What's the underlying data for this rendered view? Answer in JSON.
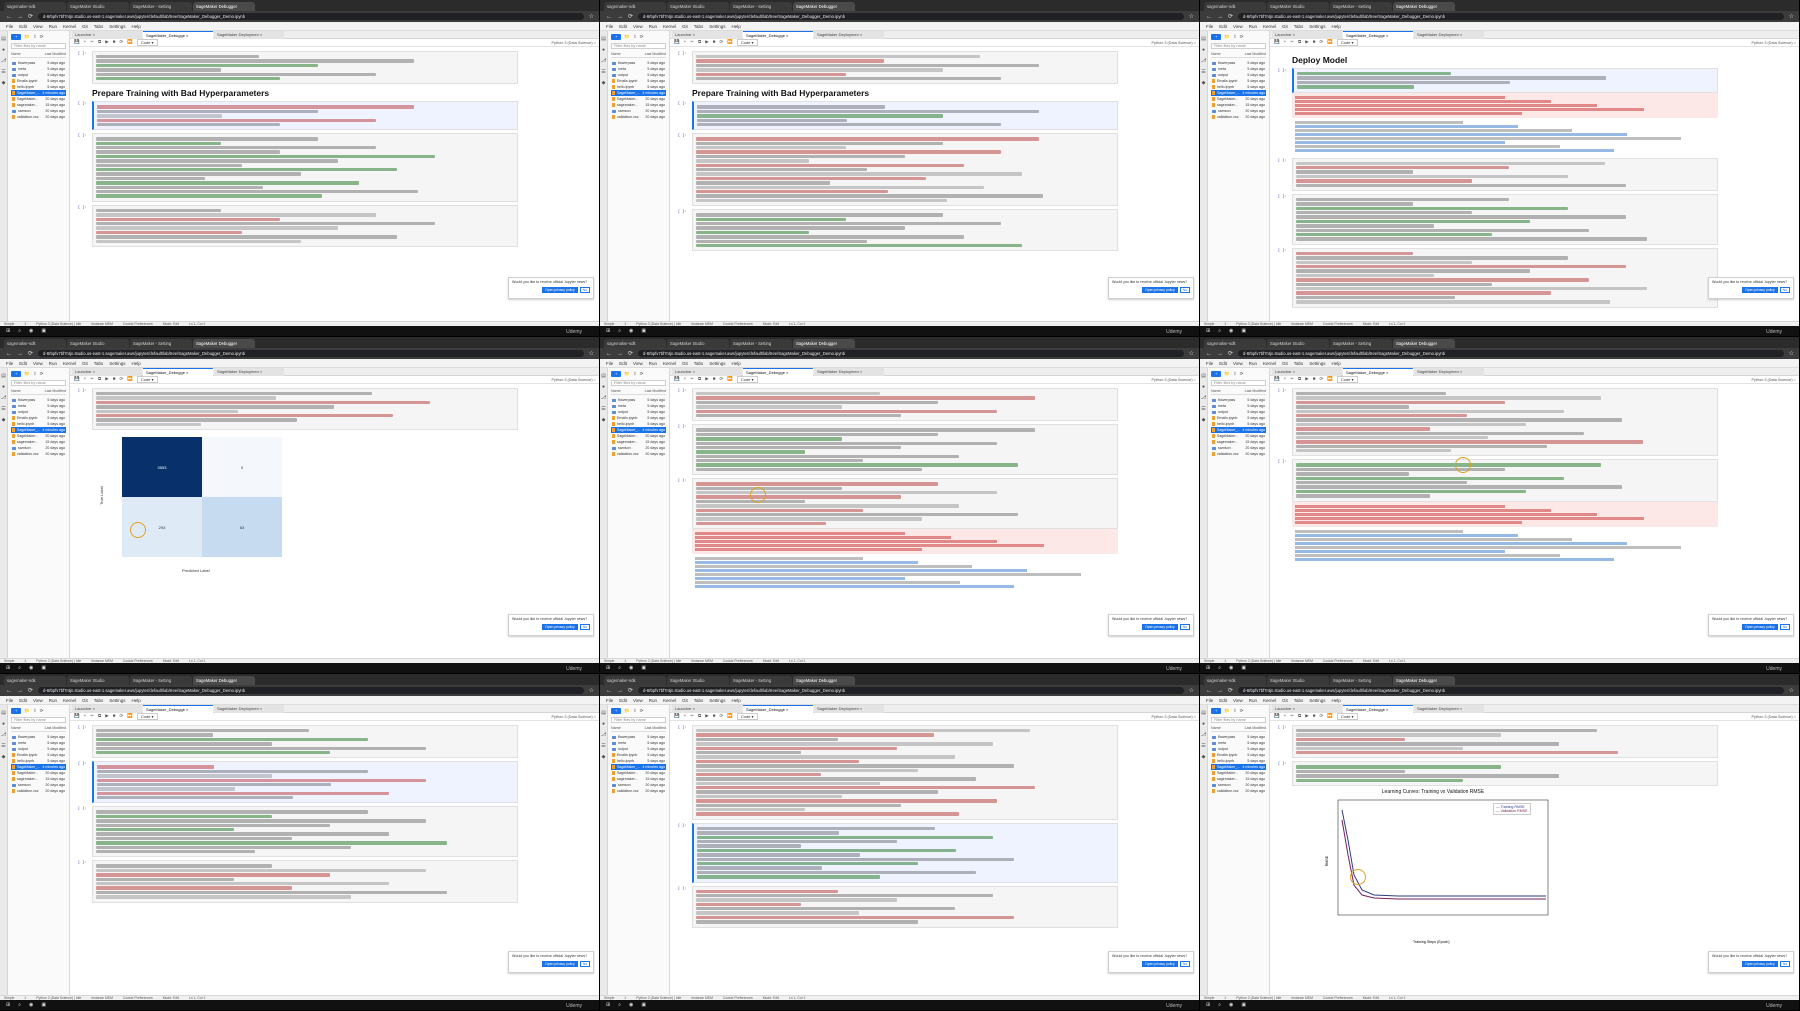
{
  "browser": {
    "tabs": [
      "sagemaker-sdk",
      "SageMaker Studio",
      "SageMaker - Setting",
      "SageMaker Debugger"
    ],
    "url": "d-8rbpfv7bf7ntjn.studio.us-east-1.sagemaker.aws/jupyter/default/lab/tree/SageMaker_Debugger_Demo.ipynb"
  },
  "menu": [
    "File",
    "Edit",
    "View",
    "Run",
    "Kernel",
    "Git",
    "Tabs",
    "Settings",
    "Help"
  ],
  "filepanel": {
    "launcher_label": "+",
    "search_placeholder": "Filter files by name",
    "col_name": "Name",
    "col_modified": "Last Modified",
    "files": [
      {
        "name": "flowerpass",
        "mod": "5 days ago",
        "type": "folder"
      },
      {
        "name": "meta",
        "mod": "5 days ago",
        "type": "folder"
      },
      {
        "name": "output",
        "mod": "5 days ago",
        "type": "folder"
      },
      {
        "name": "Emails.ipynb",
        "mod": "5 days ago",
        "type": "nb"
      },
      {
        "name": "hello.ipynb",
        "mod": "5 days ago",
        "type": "nb"
      },
      {
        "name": "SageMaker_...",
        "mod": "4 minutes ago",
        "type": "nb",
        "selected": true
      },
      {
        "name": "SageMaker...",
        "mod": "20 days ago",
        "type": "nb"
      },
      {
        "name": "sagemaker...",
        "mod": "15 days ago",
        "type": "nb"
      },
      {
        "name": "samson",
        "mod": "20 days ago",
        "type": "folder"
      },
      {
        "name": "validation.csv",
        "mod": "20 days ago",
        "type": "file"
      }
    ]
  },
  "notebook_tabs": [
    "Launcher",
    "SageMaker_Debugge",
    "SageMaker Deploymen"
  ],
  "toolbar": {
    "cell_type": "Code",
    "kernel": "Python 3 (Data Science)"
  },
  "headings": {
    "prepare": "Prepare Training with Bad Hyperparameters",
    "deploy": "Deploy Model"
  },
  "confusion_matrix": {
    "xlabel": "Predicted Label",
    "ylabel": "True Label",
    "cells": [
      "3553",
      "0",
      "293",
      "83"
    ]
  },
  "learning_curve": {
    "title": "Learning Curves: Training vs Validation RMSE",
    "legend": [
      "Training RMSE",
      "Validation RMSE"
    ],
    "xlabel": "Training Steps (Epoch)",
    "ylabel": "RMSE"
  },
  "notification": {
    "text": "Would you like to receive official Jupyter news?",
    "yes": "Open privacy policy",
    "no": "No"
  },
  "statusbar": [
    "Simple",
    "1",
    "Python 3 (Data Science) | Idle",
    "Instance MEM",
    "Cookie Preferences",
    "Mode: Edit",
    "Ln 1, Col 1"
  ],
  "taskbar_brand": "Udemy"
}
